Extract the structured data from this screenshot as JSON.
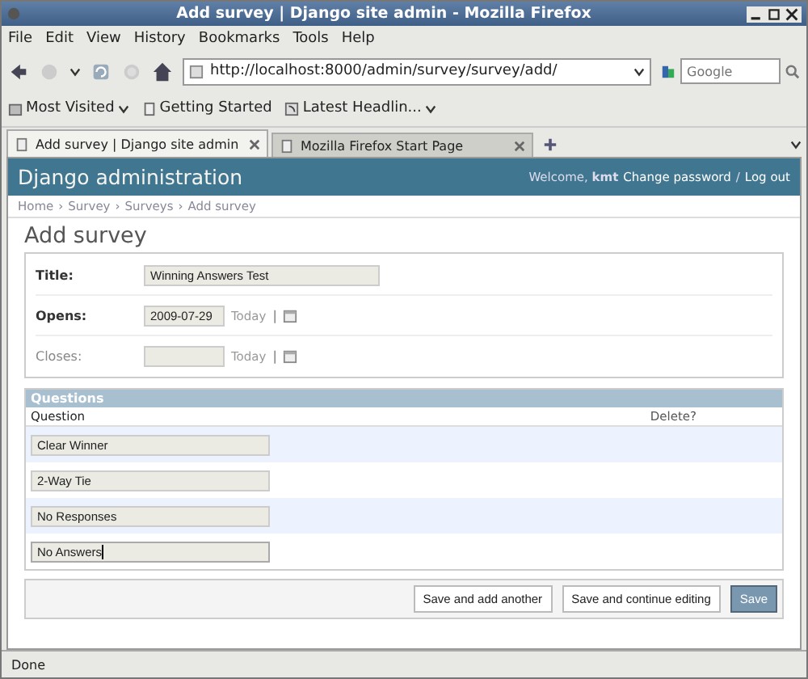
{
  "window": {
    "title": "Add survey | Django site admin - Mozilla Firefox"
  },
  "menu": [
    "File",
    "Edit",
    "View",
    "History",
    "Bookmarks",
    "Tools",
    "Help"
  ],
  "address": {
    "url": "http://localhost:8000/admin/survey/survey/add/"
  },
  "search": {
    "placeholder": "Google"
  },
  "bookmarks": [
    {
      "label": "Most Visited",
      "kind": "folder"
    },
    {
      "label": "Getting Started",
      "kind": "page"
    },
    {
      "label": "Latest Headlin...",
      "kind": "feed"
    }
  ],
  "tabs": [
    {
      "label": "Add survey | Django site admin",
      "selected": true
    },
    {
      "label": "Mozilla Firefox Start Page",
      "selected": false
    }
  ],
  "admin": {
    "site_title": "Django administration",
    "welcome": "Welcome,",
    "user": "kmt",
    "links": [
      "Change password",
      "/",
      "Log out"
    ]
  },
  "breadcrumbs": [
    "Home",
    "›",
    "Survey",
    "›",
    "Surveys",
    "›",
    "Add survey"
  ],
  "heading": "Add survey",
  "fields": [
    {
      "label": "Title:",
      "value": "Winning Answers Test",
      "required": true,
      "kind": "text"
    },
    {
      "label": "Opens:",
      "value": "2009-07-29",
      "required": true,
      "kind": "date",
      "today": "Today",
      "separator": "|"
    },
    {
      "label": "Closes:",
      "required": false,
      "kind": "date",
      "today": "Today",
      "separator": "|"
    }
  ],
  "inline": {
    "title": "Questions",
    "columns": [
      "Question",
      "Delete?"
    ],
    "rows": [
      {
        "value": "Clear Winner",
        "focused": false
      },
      {
        "value": "2-Way Tie",
        "focused": false
      },
      {
        "value": "No Responses",
        "focused": false
      },
      {
        "value": "No Answers",
        "focused": true
      }
    ]
  },
  "buttons": [
    {
      "label": "Save and add another",
      "default": false
    },
    {
      "label": "Save and continue editing",
      "default": false
    },
    {
      "label": "Save",
      "default": true
    }
  ],
  "status_bar": "Done"
}
